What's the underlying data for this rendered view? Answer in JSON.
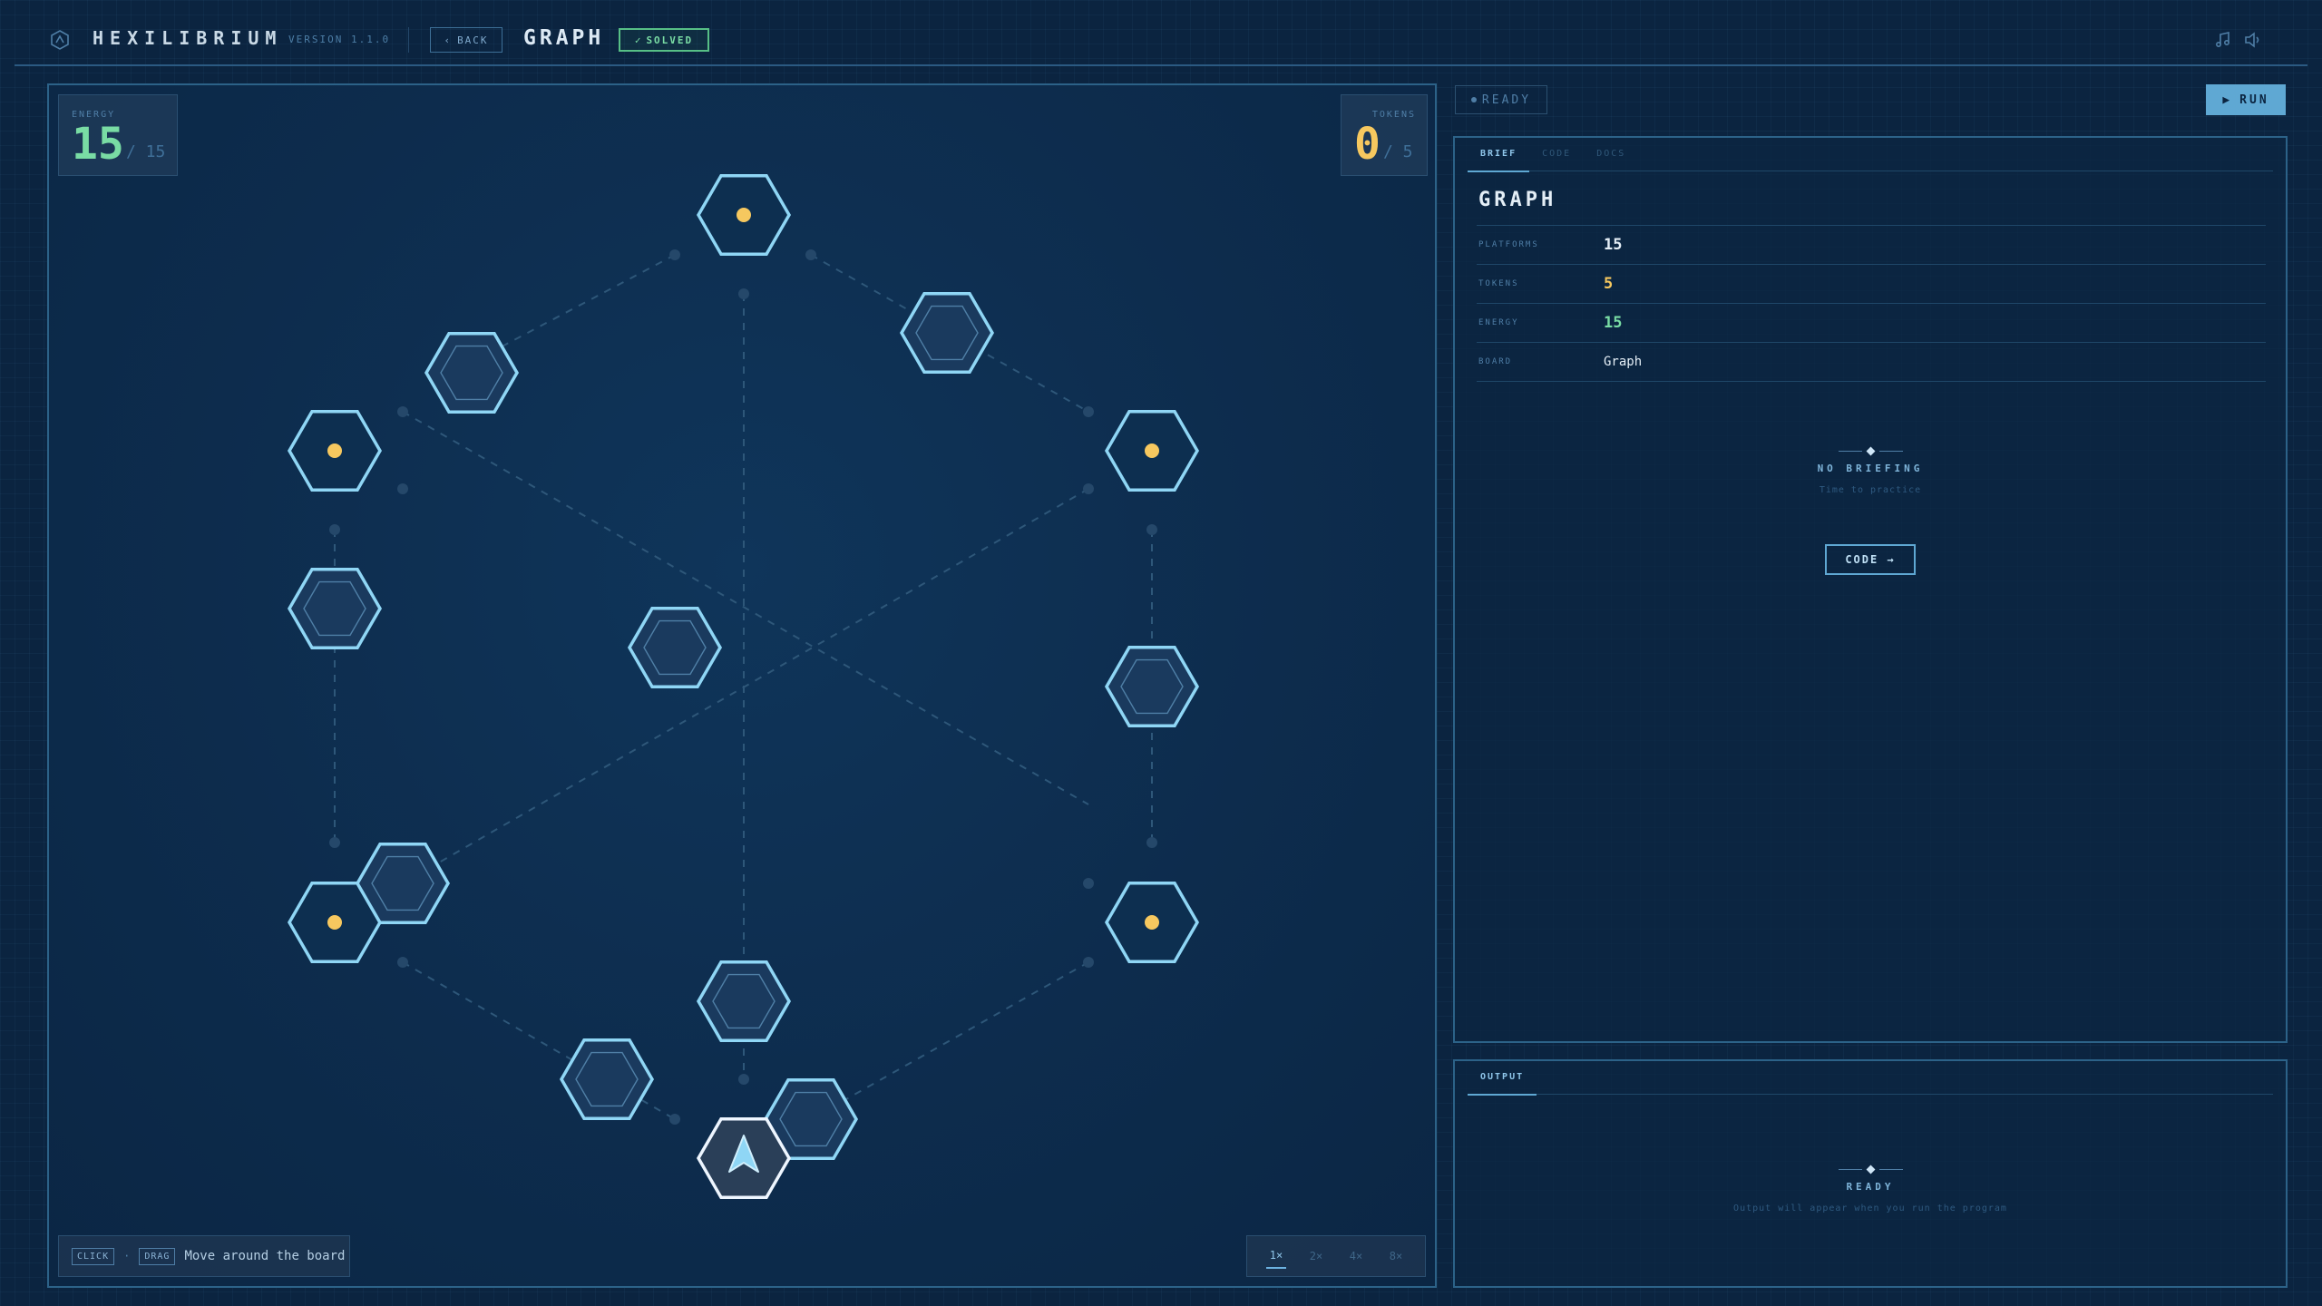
{
  "header": {
    "app_name": "HEXILIBRIUM",
    "version": "VERSION 1.1.0",
    "back_label": "BACK",
    "puzzle_title": "GRAPH",
    "solved_badge": "SOLVED",
    "icons": [
      "music-icon",
      "volume-icon"
    ]
  },
  "board": {
    "energy": {
      "label": "ENERGY",
      "value": "15",
      "max": "/ 15"
    },
    "tokens": {
      "label": "TOKENS",
      "value": "0",
      "max": "/ 5"
    },
    "hint": {
      "key_click": "CLICK",
      "separator": "·",
      "key_drag": "DRAG",
      "text": "Move around the board"
    },
    "speeds": [
      "1×",
      "2×",
      "4×",
      "8×"
    ],
    "active_speed": "1×"
  },
  "panel": {
    "status": "READY",
    "run_label": "RUN",
    "tabs": [
      "BRIEF",
      "CODE",
      "DOCS"
    ],
    "active_tab": "BRIEF",
    "brief_title": "GRAPH",
    "info": [
      {
        "key": "PLATFORMS",
        "value": "15",
        "color": "#e4eef6"
      },
      {
        "key": "TOKENS",
        "value": "5",
        "color": "#f6c85f"
      },
      {
        "key": "ENERGY",
        "value": "15",
        "color": "#79dca4"
      },
      {
        "key": "BOARD",
        "value": "Graph",
        "color": "#e4eef6"
      }
    ],
    "empty_title": "NO BRIEFING",
    "empty_sub": "Time to practice",
    "code_button": "CODE →"
  },
  "output": {
    "tab": "OUTPUT",
    "title": "READY",
    "sub": "Output will appear when you run the program"
  },
  "colors": {
    "accent": "#5fa8d3",
    "hex_stroke": "#8fd6f5",
    "token": "#f6c85f",
    "energy": "#79dca4",
    "solved": "#57bf86"
  },
  "hex_tiles": [
    {
      "token": true
    },
    {
      "token": false
    },
    {
      "token": false
    },
    {
      "token": true
    },
    {
      "token": true
    },
    {
      "token": false
    },
    {
      "token": false
    },
    {
      "token": false
    },
    {
      "token": true
    },
    {
      "token": false
    },
    {
      "token": false
    },
    {
      "token": true
    },
    {
      "token": false
    },
    {
      "token": false
    },
    {
      "token": false
    }
  ],
  "player": {
    "icon": "player-arrow-icon"
  }
}
